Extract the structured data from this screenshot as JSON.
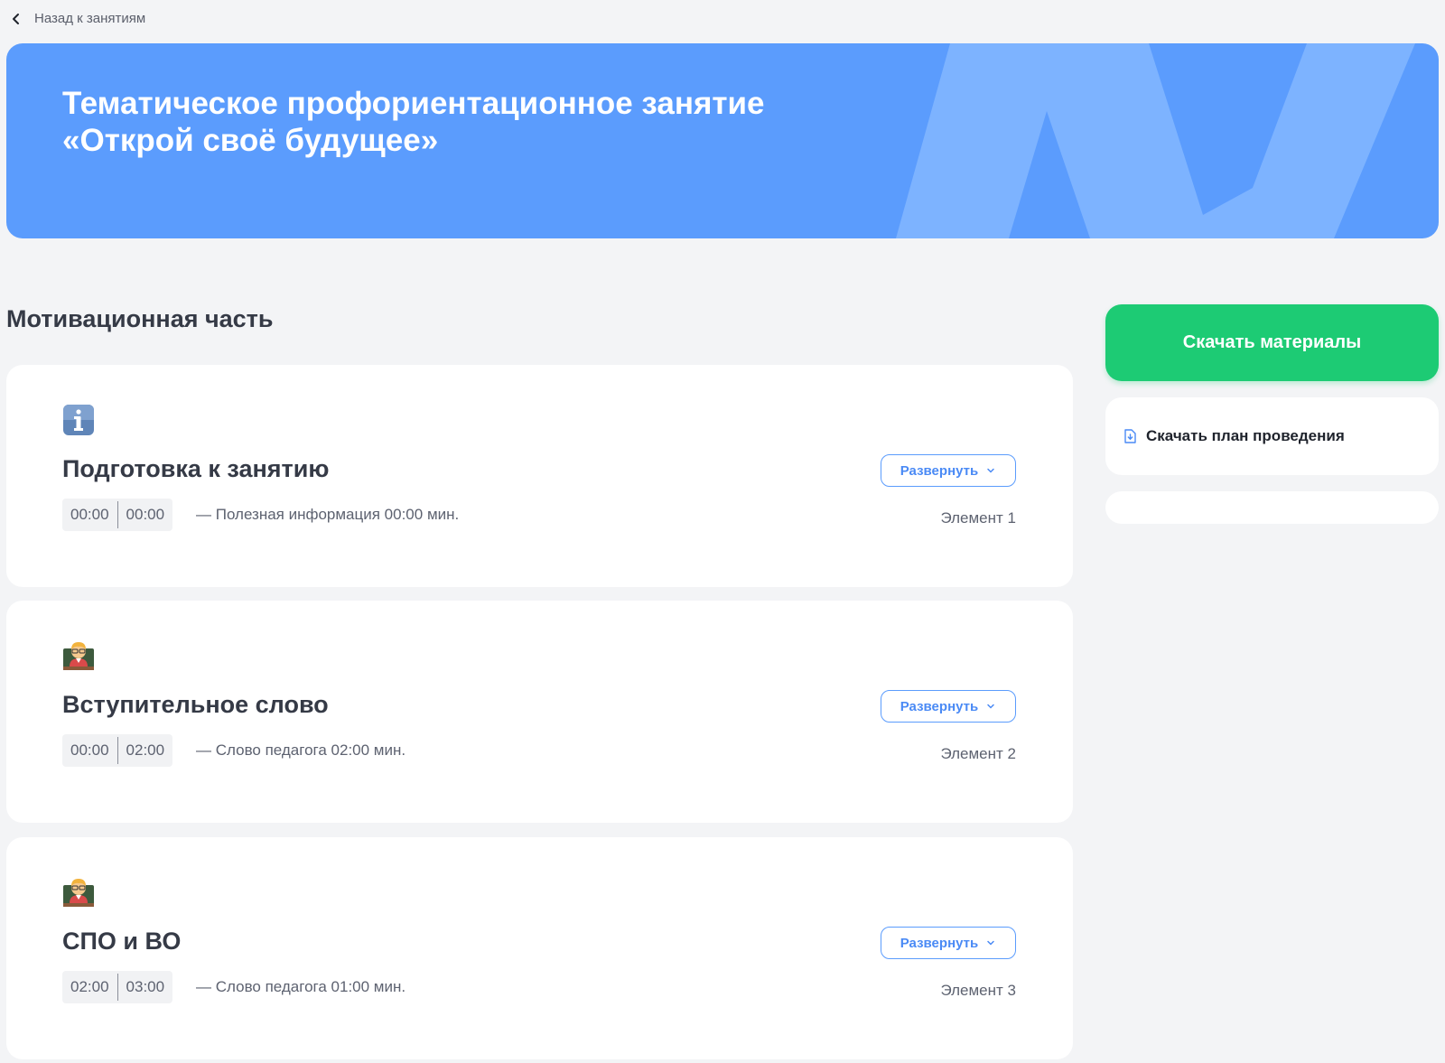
{
  "nav": {
    "back_label": "Назад к занятиям"
  },
  "hero": {
    "title_line1": "Тематическое профориентационное занятие",
    "title_line2": "«Открой своё будущее»",
    "bg_color": "#5b9cfd"
  },
  "section": {
    "title": "Мотивационная часть"
  },
  "steps": [
    {
      "icon": "information-icon",
      "title": "Подготовка к занятию",
      "time_start": "00:00",
      "time_end": "00:00",
      "description": "— Полезная информация 00:00 мин.",
      "expand_label": "Развернуть",
      "element_label": "Элемент 1"
    },
    {
      "icon": "teacher-icon",
      "title": "Вступительное слово",
      "time_start": "00:00",
      "time_end": "02:00",
      "description": "— Слово педагога 02:00 мин.",
      "expand_label": "Развернуть",
      "element_label": "Элемент 2"
    },
    {
      "icon": "teacher-icon",
      "title": "СПО и ВО",
      "time_start": "02:00",
      "time_end": "03:00",
      "description": "— Слово педагога 01:00 мин.",
      "expand_label": "Развернуть",
      "element_label": "Элемент 3"
    }
  ],
  "sidebar": {
    "download_materials_label": "Скачать материалы",
    "download_plan_label": "Скачать план проведения",
    "accent_green": "#1dcb74"
  }
}
